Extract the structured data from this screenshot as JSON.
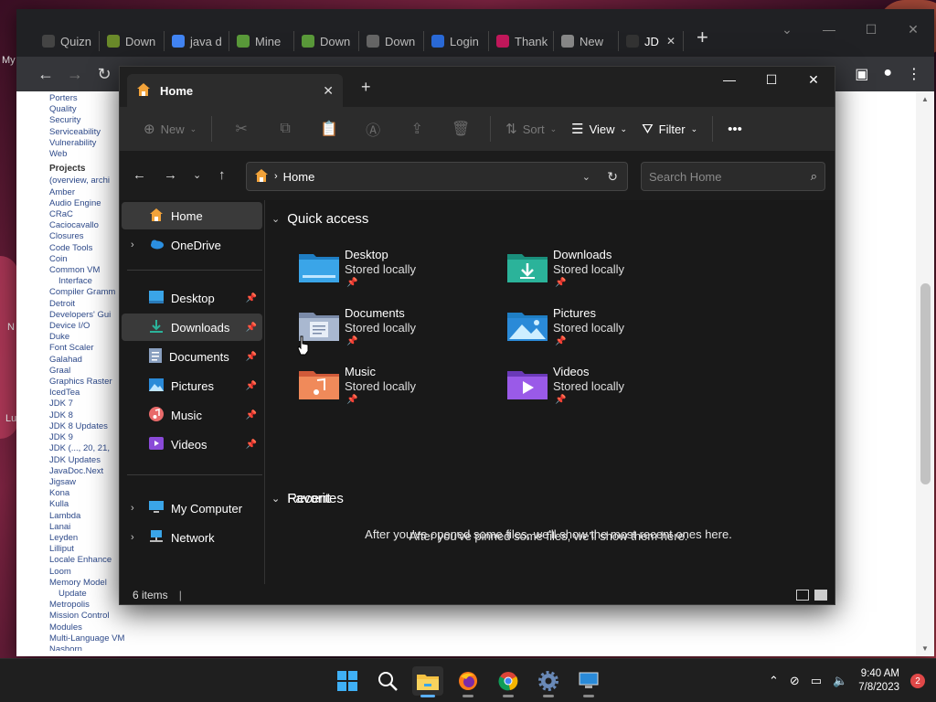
{
  "chrome": {
    "tabs": [
      {
        "label": "Quizn",
        "icon": "quizlet-icon",
        "color": "#444"
      },
      {
        "label": "Down",
        "icon": "leaf-icon",
        "color": "#6a8a2a"
      },
      {
        "label": "java d",
        "icon": "google-icon",
        "color": "#4285f4"
      },
      {
        "label": "Mine",
        "icon": "minecraft-icon",
        "color": "#5a9a3a"
      },
      {
        "label": "Down",
        "icon": "minecraft-icon",
        "color": "#5a9a3a"
      },
      {
        "label": "Down",
        "icon": "download-icon",
        "color": "#666"
      },
      {
        "label": "Login",
        "icon": "azure-icon",
        "color": "#2a6ad8"
      },
      {
        "label": "Thank",
        "icon": "delta-icon",
        "color": "#c2185b"
      },
      {
        "label": "New",
        "icon": "chrome-icon",
        "color": "#888"
      },
      {
        "label": "JD",
        "icon": "duke-icon",
        "color": "#333"
      }
    ],
    "sidenav": {
      "top_items": [
        "Porters",
        "Quality",
        "Security",
        "Serviceability",
        "Vulnerability",
        "Web"
      ],
      "group_title": "Projects",
      "items": [
        "(overview, archi",
        "Amber",
        "Audio Engine",
        "CRaC",
        "Caciocavallo",
        "Closures",
        "Code Tools",
        "Coin",
        "Common VM",
        "Interface",
        "Compiler Gramm",
        "Detroit",
        "Developers' Gui",
        "Device I/O",
        "Duke",
        "Font Scaler",
        "Galahad",
        "Graal",
        "Graphics Raster",
        "IcedTea",
        "JDK 7",
        "JDK 8",
        "JDK 8 Updates",
        "JDK 9",
        "JDK (..., 20, 21,",
        "JDK Updates",
        "JavaDoc.Next",
        "Jigsaw",
        "Kona",
        "Kulla",
        "Lambda",
        "Lanai",
        "Leyden",
        "Lilliput",
        "Locale Enhance",
        "Loom",
        "Memory Model",
        "Update",
        "Metropolis",
        "Mission Control",
        "Modules",
        "Multi-Language VM",
        "Nashorn"
      ]
    }
  },
  "desktop": {
    "labels": [
      "My",
      "N",
      "Lu"
    ]
  },
  "explorer": {
    "tab_title": "Home",
    "commands": {
      "new": "New",
      "sort": "Sort",
      "view": "View",
      "filter": "Filter"
    },
    "address": "Home",
    "search_placeholder": "Search Home",
    "nav": {
      "home": "Home",
      "onedrive": "OneDrive",
      "pinned": [
        {
          "label": "Desktop",
          "icon": "desktop-icon"
        },
        {
          "label": "Downloads",
          "icon": "downloads-icon"
        },
        {
          "label": "Documents",
          "icon": "documents-icon"
        },
        {
          "label": "Pictures",
          "icon": "pictures-icon"
        },
        {
          "label": "Music",
          "icon": "music-icon"
        },
        {
          "label": "Videos",
          "icon": "videos-icon"
        }
      ],
      "my_computer": "My Computer",
      "network": "Network"
    },
    "quick_access_title": "Quick access",
    "quick_access": [
      {
        "name": "Desktop",
        "status": "Stored locally"
      },
      {
        "name": "Downloads",
        "status": "Stored locally"
      },
      {
        "name": "Documents",
        "status": "Stored locally"
      },
      {
        "name": "Pictures",
        "status": "Stored locally"
      },
      {
        "name": "Music",
        "status": "Stored locally"
      },
      {
        "name": "Videos",
        "status": "Stored locally"
      }
    ],
    "favorites_title": "Favorites",
    "favorites_empty": "After you've pinned some files, we'll show them here.",
    "recent_title": "Recent",
    "recent_empty": "After you've opened some files, we'll show the most recent ones here.",
    "status_items": "6 items"
  },
  "taskbar": {
    "time": "9:40 AM",
    "date": "7/8/2023",
    "notifications": "2"
  },
  "colors": {
    "accent": "#5ab0ff",
    "explorer_bg": "#191919",
    "folder_blue": "#3a9ad9",
    "folder_teal": "#2bb39a"
  }
}
